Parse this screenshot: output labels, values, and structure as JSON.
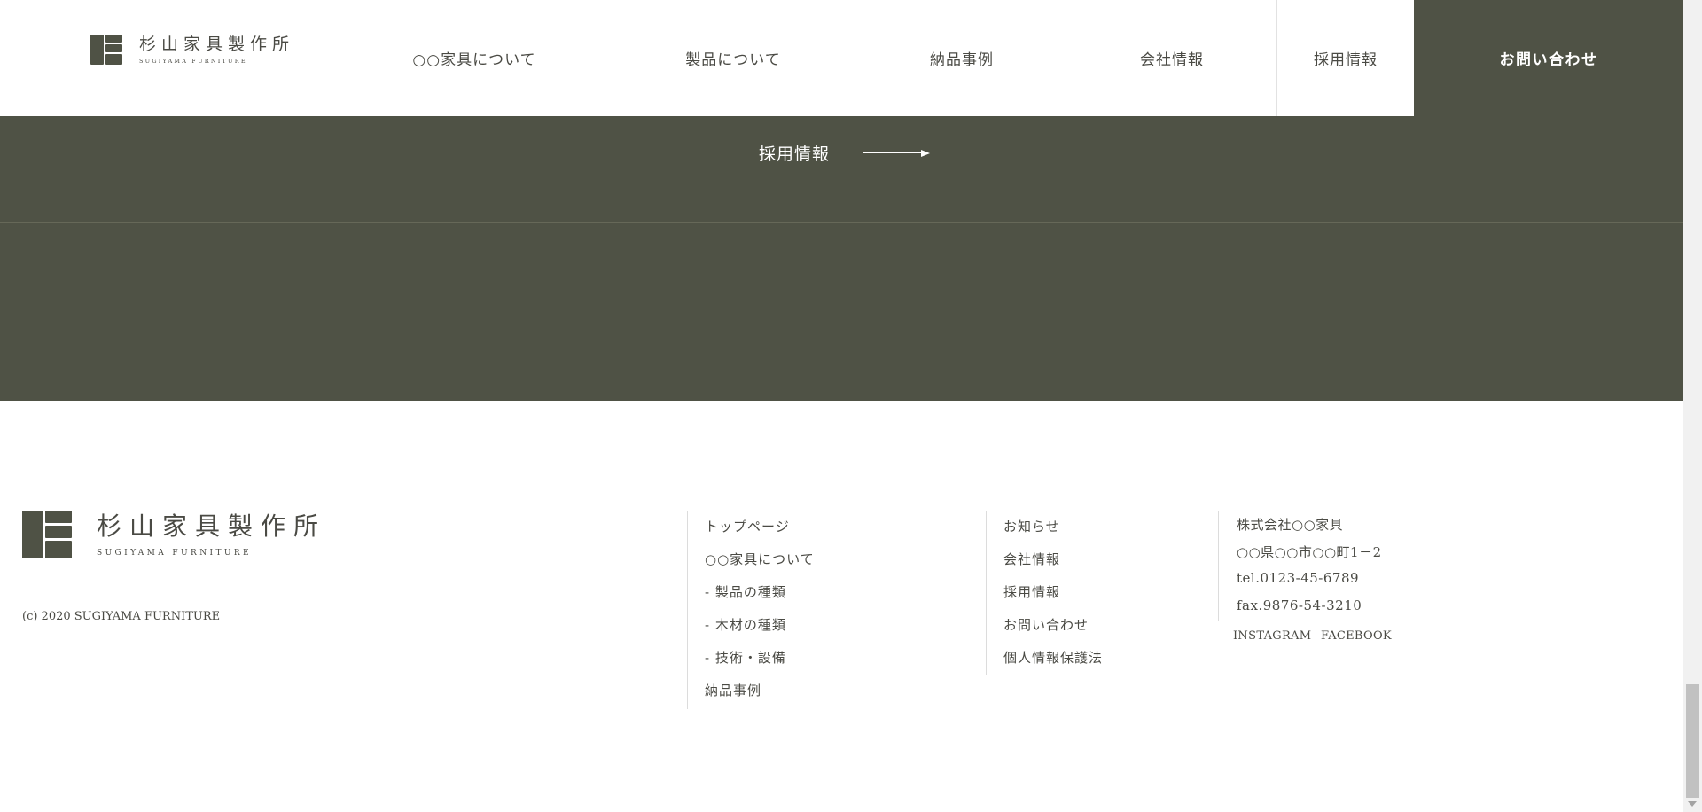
{
  "brand": {
    "name_jp": "杉山家具製作所",
    "name_en": "SUGIYAMA FURNITURE",
    "color": "#4f5245"
  },
  "nav": {
    "items": [
      {
        "label": "○○家具について"
      },
      {
        "label": "製品について"
      },
      {
        "label": "納品事例"
      },
      {
        "label": "会社情報"
      },
      {
        "label": "採用情報"
      }
    ],
    "contact_label": "お問い合わせ"
  },
  "band": {
    "link_label": "採用情報",
    "arrow_icon": "arrow-right-icon"
  },
  "footer": {
    "copyright": "(c) 2020 SUGIYAMA FURNITURE",
    "col1": [
      "トップページ",
      "○○家具について",
      "- 製品の種類",
      "- 木材の種類",
      "- 技術・設備",
      "納品事例"
    ],
    "col2": [
      "お知らせ",
      "会社情報",
      "採用情報",
      "お問い合わせ",
      "個人情報保護法"
    ],
    "company": {
      "name": "株式会社○○家具",
      "address": "○○県○○市○○町1－2",
      "tel": "tel.0123-45-6789",
      "fax": "fax.9876-54-3210"
    },
    "social": [
      "INSTAGRAM",
      "FACEBOOK"
    ]
  }
}
